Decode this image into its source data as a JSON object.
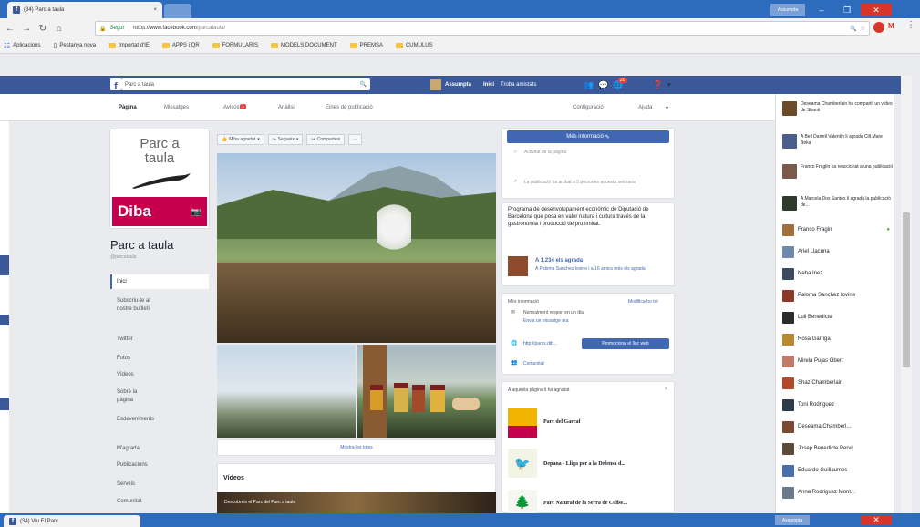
{
  "browser": {
    "tab_title": "(34) Parc a taula",
    "tab_close": "×",
    "profile_button": "Assumpta",
    "url_secure": "Segur",
    "url_host": "https://www.facebook.com",
    "url_path": "/parcataula/",
    "bottom_tab_title": "(34) Viu El Parc"
  },
  "bookmarks": [
    "Aplicacions",
    "Pestanya nova",
    "Importat d'IE",
    "APPS i QR",
    "FORMULARIS",
    "MODELS DOCUMENT",
    "PREMSA",
    "CUMULUS"
  ],
  "fb": {
    "search_value": "Parc a taula",
    "user_name": "Assumpta",
    "inici": "Inici",
    "create_label": "Troba amistats",
    "notif_badge": "20"
  },
  "page_tabs": [
    "Pàgina",
    "Missatges",
    "Avisos",
    "Anàlisi",
    "Eines de publicació"
  ],
  "page_tabs_right": [
    "Configuració",
    "Ajuda"
  ],
  "avisos_badge": "1",
  "left": {
    "logo_line1": "Parc a",
    "logo_line2": "taula",
    "logo_brand": "Diba",
    "page_name": "Parc a taula",
    "handle": "@parcataula",
    "nav": [
      "Inici",
      "Subscriu-te al nostre butlletí",
      "Twitter",
      "Fotos",
      "Vídeos",
      "Sobre la pàgina",
      "Esdeveniments",
      "M'agrada",
      "Publicacions",
      "Serveis",
      "Comunitat"
    ]
  },
  "actions": {
    "like": "M'ha agradat",
    "follow": "Segueix",
    "share": "Comparteix",
    "more": "···"
  },
  "photos": {
    "see_all": "Mostra-les totes",
    "videos_title": "Vídeos",
    "video_caption": "Descobreix el Parc del Parc a taula"
  },
  "right": {
    "more_info_button": "Més informació",
    "activity1": "Activitat de la pàgina",
    "activity2": "La publicació ha arribat a 5 persones aquesta setmana",
    "desc": "Programa de desenvolupament econòmic de Diputació de Barcelona que posa en valor natura i cultura través de la gastronomia i producció de proximitat.",
    "likes_count": "A 1.234 els agrada",
    "likes_sub": "A Paloma Sanchez Iovine i a 16 amics més els agrada",
    "info_title": "Més informació",
    "info_edit": "Modifica-ho tot",
    "response": "Normalment respon en un dia",
    "send_message": "Envia un missatge ara",
    "website": "http://parcs.dib...",
    "promote": "Promociona el lloc web",
    "community": "Comunitat",
    "liked_pages_title": "A aquesta pàgina li ha agradat",
    "liked_pages": [
      "Parc del Garraf",
      "Depana - Lliga per a la Defensa d...",
      "Parc Natural de la Serra de Collse..."
    ]
  },
  "chat": {
    "ticker": [
      "Deseama Chamberlain ha compartit un vídeo de Shanti",
      "A Bell Darrell Valentin li agrada Cilt Mare Beka",
      "Franco Fraglin ha reaccionat a una publicació",
      "A Marcela Dos Santos li agrada la publicació de..."
    ],
    "contacts": [
      "Franco Fragin",
      "Ariel Llacuna",
      "Neha Inez",
      "Paloma Sanchez Iovine",
      "Luli Benedicte",
      "Rosa Garriga",
      "Mirela Pujas Obert",
      "Shaz Chamberlain",
      "Toni Rodriguez",
      "Deseama Chamberl...",
      "Josep Benedicte Pervi",
      "Eduardo Guillaumes",
      "Anna Rodriguez Mont..."
    ]
  }
}
